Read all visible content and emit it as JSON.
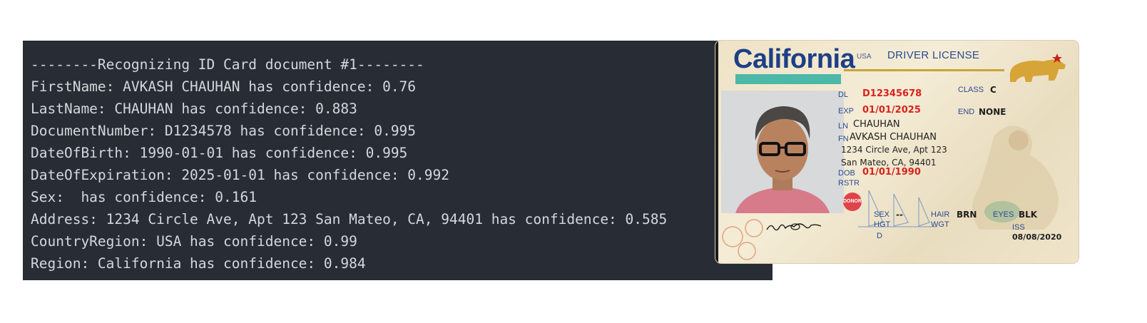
{
  "terminal": {
    "lines": [
      "--------Recognizing ID Card document #1--------",
      "FirstName: AVKASH CHAUHAN has confidence: 0.76",
      "LastName: CHAUHAN has confidence: 0.883",
      "DocumentNumber: D1234578 has confidence: 0.995",
      "DateOfBirth: 1990-01-01 has confidence: 0.995",
      "DateOfExpiration: 2025-01-01 has confidence: 0.992",
      "Sex:  has confidence: 0.161",
      "Address: 1234 Circle Ave, Apt 123 San Mateo, CA, 94401 has confidence: 0.585",
      "CountryRegion: USA has confidence: 0.99",
      "Region: California has confidence: 0.984"
    ]
  },
  "id_card": {
    "state": "California",
    "country": "USA",
    "card_type": "DRIVER LICENSE",
    "dl_label": "DL",
    "dl_number": "D12345678",
    "exp_label": "EXP",
    "exp_date": "01/01/2025",
    "class_label": "CLASS",
    "class_value": "C",
    "end_label": "END",
    "end_value": "NONE",
    "ln_label": "LN",
    "last_name": "CHAUHAN",
    "fn_label": "FN",
    "first_name": "AVKASH CHAUHAN",
    "address_line1": "1234 Circle Ave, Apt 123",
    "address_line2": "San Mateo, CA, 94401",
    "dob_label": "DOB",
    "dob": "01/01/1990",
    "rstr_label": "RSTR",
    "donor_label": "DONOR",
    "sex_label": "SEX",
    "sex_value": "--",
    "hgt_label": "HGT",
    "hair_label": "HAIR",
    "hair_value": "BRN",
    "eyes_label": "EYES",
    "eyes_value": "BLK",
    "wgt_label": "WGT",
    "d_label": "D",
    "iss_label": "ISS",
    "iss_date": "08/08/2020"
  },
  "colors": {
    "terminal_bg": "#282c34",
    "terminal_text": "#d4d8dd",
    "card_blue": "#1d3f86",
    "card_red": "#d8231c",
    "card_teal": "#4bb8a8",
    "card_gold": "#c9a43a"
  }
}
